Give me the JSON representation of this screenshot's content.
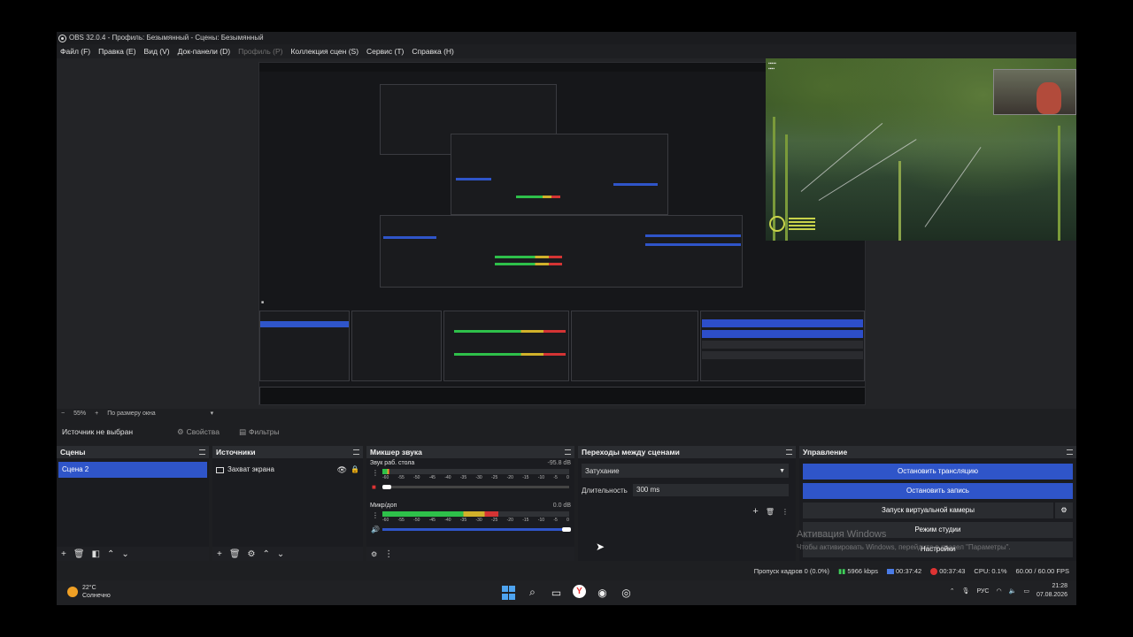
{
  "window": {
    "title": "OBS 32.0.4 - Профиль: Безымянный - Сцены: Безымянный"
  },
  "menu": [
    {
      "label": "Файл (F)",
      "disabled": false
    },
    {
      "label": "Правка (E)",
      "disabled": false
    },
    {
      "label": "Вид (V)",
      "disabled": false
    },
    {
      "label": "Док-панели (D)",
      "disabled": false
    },
    {
      "label": "Профиль (P)",
      "disabled": true
    },
    {
      "label": "Коллекция сцен (S)",
      "disabled": false
    },
    {
      "label": "Сервис (T)",
      "disabled": false
    },
    {
      "label": "Справка (H)",
      "disabled": false
    }
  ],
  "preview": {
    "zoom": "55%",
    "zoom_mode": "По размеру окна"
  },
  "source_toolbar": {
    "no_source": "Источник не выбран",
    "properties": "Свойства",
    "filters": "Фильтры"
  },
  "scenes": {
    "title": "Сцены",
    "items": [
      "Сцена 2"
    ]
  },
  "sources": {
    "title": "Источники",
    "items": [
      "Захват экрана"
    ]
  },
  "mixer": {
    "title": "Микшер звука",
    "channels": [
      {
        "name": "Звук раб. стола",
        "db": "-95.8 dB",
        "level": 0.04
      },
      {
        "name": "Микр/доп",
        "db": "0.0 dB",
        "level": 0.62
      }
    ],
    "ticks": [
      "-60",
      "-55",
      "-50",
      "-45",
      "-40",
      "-35",
      "-30",
      "-25",
      "-20",
      "-15",
      "-10",
      "-5",
      "0"
    ]
  },
  "transitions": {
    "title": "Переходы между сценами",
    "selected": "Затухание",
    "duration_label": "Длительность",
    "duration_value": "300 ms"
  },
  "controls": {
    "title": "Управление",
    "stop_stream": "Остановить трансляцию",
    "stop_record": "Остановить запись",
    "virtual_cam": "Запуск виртуальной камеры",
    "studio_mode": "Режим студии",
    "settings": "Настройки"
  },
  "activation": {
    "title": "Активация Windows",
    "subtitle": "Чтобы активировать Windows, перейдите в раздел \"Параметры\"."
  },
  "status": {
    "dropped": "Пропуск кадров 0 (0.0%)",
    "bitrate": "5966 kbps",
    "stream_time": "00:37:42",
    "rec_time": "00:37:43",
    "cpu": "CPU: 0.1%",
    "fps": "60.00 / 60.00 FPS"
  },
  "taskbar": {
    "temp": "22°C",
    "weather": "Солнечно",
    "lang": "РУС",
    "time": "21:28",
    "date": "07.08.2026"
  },
  "colors": {
    "accent": "#2f55c9",
    "meter_green": "#2ec04a",
    "meter_yellow": "#d1b12a",
    "meter_red": "#d43434",
    "status_green": "#3fd05a"
  }
}
